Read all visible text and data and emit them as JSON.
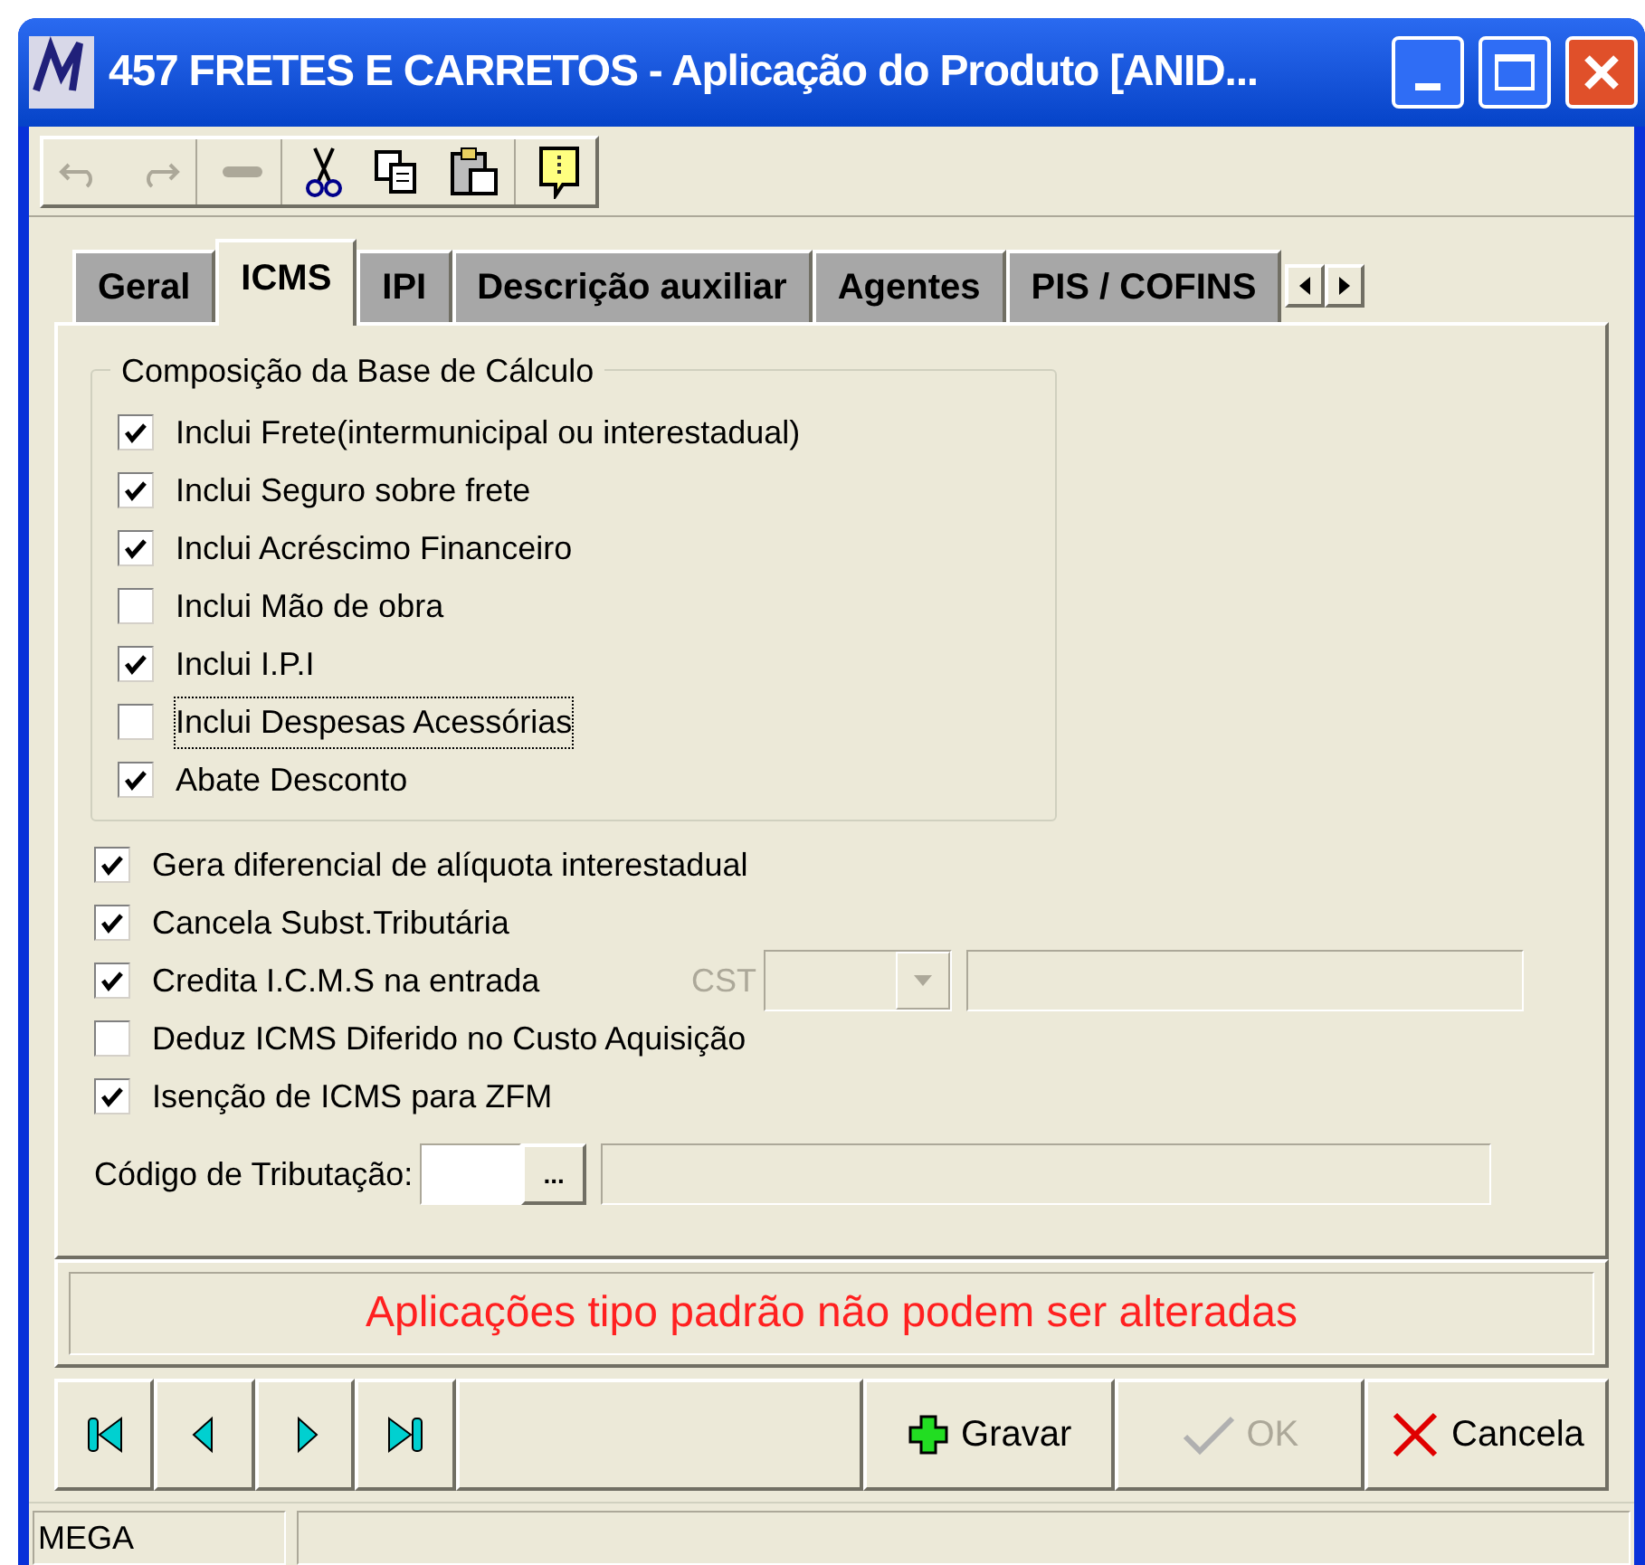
{
  "window": {
    "title": "457 FRETES E CARRETOS -  Aplicação do Produto [ANID..."
  },
  "toolbar": [
    {
      "kind": "undo",
      "disabled": true
    },
    {
      "kind": "redo",
      "disabled": true
    },
    {
      "kind": "minus",
      "disabled": true
    },
    {
      "kind": "cut",
      "disabled": false
    },
    {
      "kind": "copy",
      "disabled": false
    },
    {
      "kind": "paste",
      "disabled": false
    },
    {
      "kind": "note",
      "disabled": false
    }
  ],
  "tabs": [
    {
      "label": "Geral",
      "selected": false
    },
    {
      "label": "ICMS",
      "selected": true
    },
    {
      "label": "IPI",
      "selected": false
    },
    {
      "label": "Descrição auxiliar",
      "selected": false
    },
    {
      "label": "Agentes",
      "selected": false
    },
    {
      "label": "PIS / COFINS",
      "selected": false
    }
  ],
  "group": {
    "title": "Composição da Base de Cálculo",
    "items": [
      {
        "label": "Inclui Frete(intermunicipal ou interestadual)",
        "checked": true,
        "focused": false
      },
      {
        "label": "Inclui Seguro sobre frete",
        "checked": true,
        "focused": false
      },
      {
        "label": "Inclui Acréscimo Financeiro",
        "checked": true,
        "focused": false
      },
      {
        "label": "Inclui Mão de obra",
        "checked": false,
        "focused": false
      },
      {
        "label": "Inclui I.P.I",
        "checked": true,
        "focused": false
      },
      {
        "label": "Inclui Despesas Acessórias",
        "checked": false,
        "focused": true
      },
      {
        "label": "Abate Desconto",
        "checked": true,
        "focused": false
      }
    ]
  },
  "options": [
    {
      "label": "Gera diferencial de alíquota interestadual",
      "checked": true
    },
    {
      "label": "Cancela Subst.Tributária",
      "checked": true
    },
    {
      "label": "Credita I.C.M.S na entrada",
      "checked": true,
      "cst_label": "CST"
    },
    {
      "label": "Deduz ICMS Diferido no Custo Aquisição",
      "checked": false
    },
    {
      "label": "Isenção de ICMS para ZFM",
      "checked": true
    }
  ],
  "tributacao": {
    "label": "Código de Tributação:",
    "button": "..."
  },
  "message": "Aplicações tipo padrão não podem ser alteradas",
  "buttons": [
    {
      "kind": "save",
      "label": "Gravar",
      "disabled": false
    },
    {
      "kind": "ok",
      "label": "OK",
      "disabled": true
    },
    {
      "kind": "cancel",
      "label": "Cancela",
      "disabled": false
    }
  ],
  "status_bar": {
    "panel_1": "MEGA"
  }
}
